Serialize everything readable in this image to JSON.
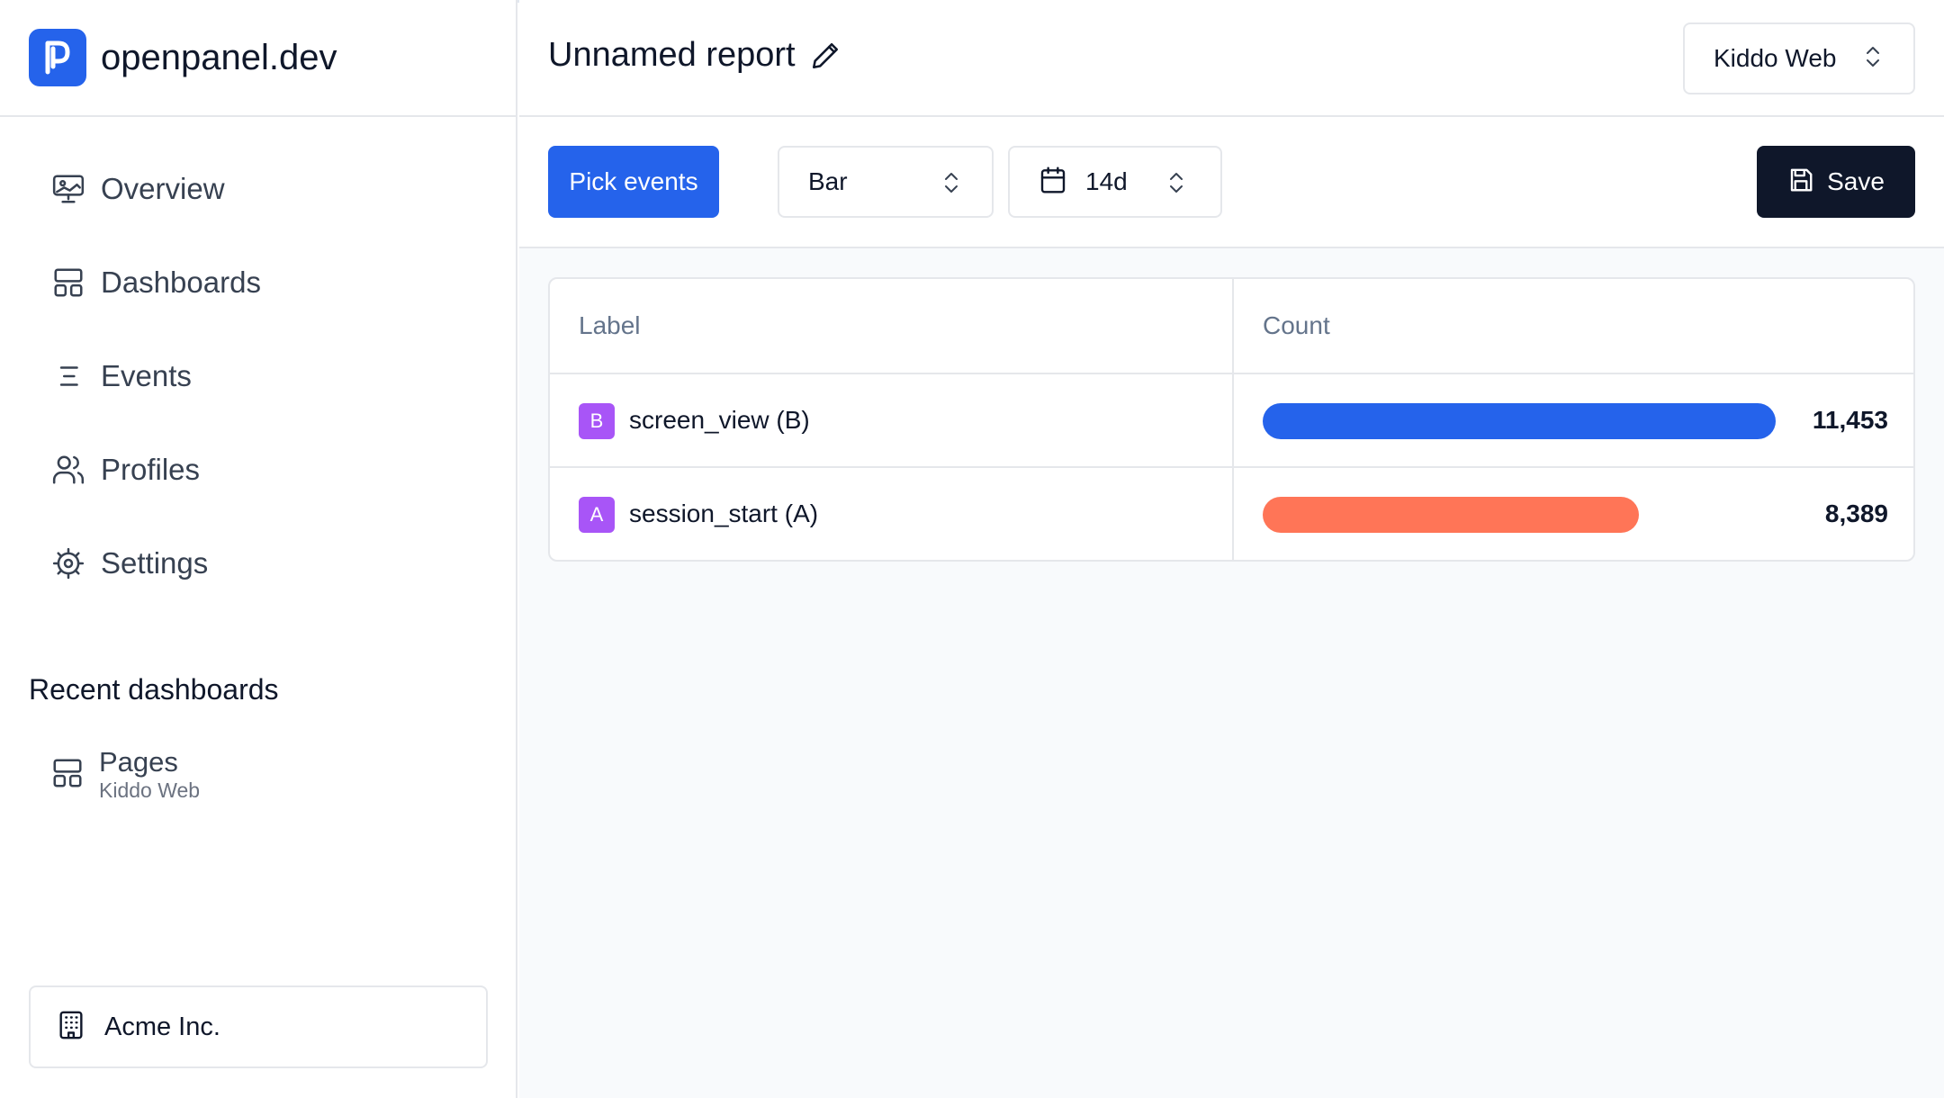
{
  "brand": {
    "name": "openpanel.dev",
    "logo_letter": "P",
    "color": "#2563eb"
  },
  "sidebar": {
    "items": [
      {
        "label": "Overview",
        "icon": "presentation-icon"
      },
      {
        "label": "Dashboards",
        "icon": "layout-panel-icon"
      },
      {
        "label": "Events",
        "icon": "list-filter-icon"
      },
      {
        "label": "Profiles",
        "icon": "users-icon"
      },
      {
        "label": "Settings",
        "icon": "cog-icon"
      }
    ],
    "recent_title": "Recent dashboards",
    "recent": [
      {
        "title": "Pages",
        "subtitle": "Kiddo Web",
        "icon": "layout-panel-icon"
      }
    ],
    "org": {
      "label": "Acme Inc.",
      "icon": "building-icon"
    }
  },
  "header": {
    "title": "Unnamed report",
    "project": "Kiddo Web"
  },
  "toolbar": {
    "pick_events": "Pick events",
    "chart_type": "Bar",
    "range": "14d",
    "save": "Save"
  },
  "table": {
    "columns": [
      "Label",
      "Count"
    ],
    "rows": [
      {
        "badge": "B",
        "label": "screen_view (B)",
        "value": "11,453",
        "count": 11453,
        "color": "#2563eb"
      },
      {
        "badge": "A",
        "label": "session_start (A)",
        "value": "8,389",
        "count": 8389,
        "color": "#ff7557"
      }
    ]
  },
  "chart_data": {
    "type": "bar",
    "categories": [
      "screen_view (B)",
      "session_start (A)"
    ],
    "values": [
      11453,
      8389
    ],
    "colors": [
      "#2563eb",
      "#ff7557"
    ],
    "title": "Unnamed report",
    "xlabel": "",
    "ylabel": "Count"
  }
}
